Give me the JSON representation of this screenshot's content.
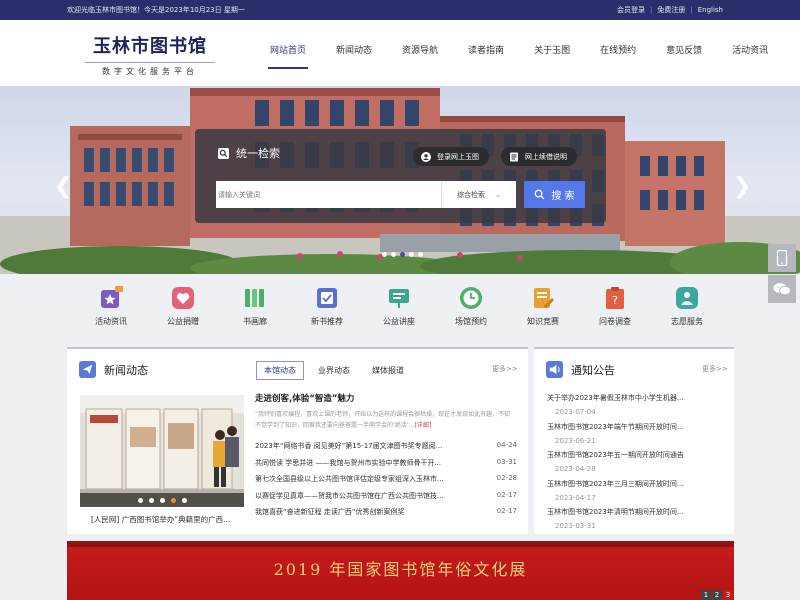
{
  "topbar": {
    "welcome": "欢迎光临玉林市图书馆！今天是2023年10月23日 星期一",
    "login": "会员登录",
    "register": "免费注册",
    "english": "English",
    "separator": "|"
  },
  "logo": {
    "title": "玉林市图书馆",
    "subtitle": "数字文化服务平台"
  },
  "nav": [
    "网站首页",
    "新闻动态",
    "资源导航",
    "读者指南",
    "关于玉图",
    "在线预约",
    "意见反馈",
    "活动资讯"
  ],
  "search": {
    "title": "统一检索",
    "btn_login": "登录网上玉图",
    "btn_renew": "网上续借说明",
    "placeholder": "请输入关键词",
    "type": "综合检索",
    "submit": "搜 索"
  },
  "services": [
    {
      "label": "活动资讯",
      "icon": "activity-icon",
      "color": "#7b5cc4"
    },
    {
      "label": "公益捐赠",
      "icon": "heart-icon",
      "color": "#e0657a"
    },
    {
      "label": "书画廊",
      "icon": "books-icon",
      "color": "#4caf6a"
    },
    {
      "label": "新书推荐",
      "icon": "new-book-icon",
      "color": "#5a6fd6"
    },
    {
      "label": "公益讲座",
      "icon": "lecture-icon",
      "color": "#3aa88e"
    },
    {
      "label": "场馆预约",
      "icon": "clock-icon",
      "color": "#4caf6a"
    },
    {
      "label": "知识竞赛",
      "icon": "quiz-icon",
      "color": "#e8a030"
    },
    {
      "label": "问卷调查",
      "icon": "survey-icon",
      "color": "#e06040"
    },
    {
      "label": "志愿服务",
      "icon": "volunteer-icon",
      "color": "#3aa8a0"
    }
  ],
  "news": {
    "title": "新闻动态",
    "tabs": [
      "本馆动态",
      "业界动态",
      "媒体报道"
    ],
    "more": "更多>>",
    "photo_caption": "[人民网] 广西图书馆举办“典籍里的广西...",
    "headline": "走进创客,体验“智造”魅力",
    "summary": "“我特别喜欢编程，喜欢上课的老师，开始以为这样的课程会很枯燥，现在才发现如此有趣，不知不觉学到了知识，回家我还要向爸爸露一手啊学会的‘绝活’...",
    "detail": "[详细]",
    "items": [
      {
        "text": "2023年“网络书香 阅见美好”第15-17届文津图书奖专题阅...",
        "date": "04-24"
      },
      {
        "text": "共同悦读 学思并进 ——我馆与贺州市实验中学教师骨干开...",
        "date": "03-31"
      },
      {
        "text": "第七次全国县级以上公共图书馆评估定级专家组深入玉林市...",
        "date": "02-28"
      },
      {
        "text": "以赛促学见真章——贺我市公共图书馆在广西公共图书馆技...",
        "date": "02-17"
      },
      {
        "text": "我馆喜获“奋进新征程 走读广西”优秀创新案例奖",
        "date": "02-17"
      }
    ]
  },
  "notice": {
    "title": "通知公告",
    "more": "更多>>",
    "items": [
      {
        "text": "关于举办2023年暑假玉林市中小学生机器...",
        "date": "2023-07-04"
      },
      {
        "text": "玉林市图书馆2023年端午节期间开放时间...",
        "date": "2023-06-21"
      },
      {
        "text": "玉林市图书馆2023年五一期间开放时间通告",
        "date": "2023-04-28"
      },
      {
        "text": "玉林市图书馆2023年三月三期间开放时间...",
        "date": "2023-04-17"
      },
      {
        "text": "玉林市图书馆2023年清明节期间开放时间...",
        "date": "2023-03-31"
      }
    ]
  },
  "exhibit": {
    "title": "2019 年国家图书馆年俗文化展",
    "pages": [
      "1",
      "2",
      "3"
    ]
  }
}
